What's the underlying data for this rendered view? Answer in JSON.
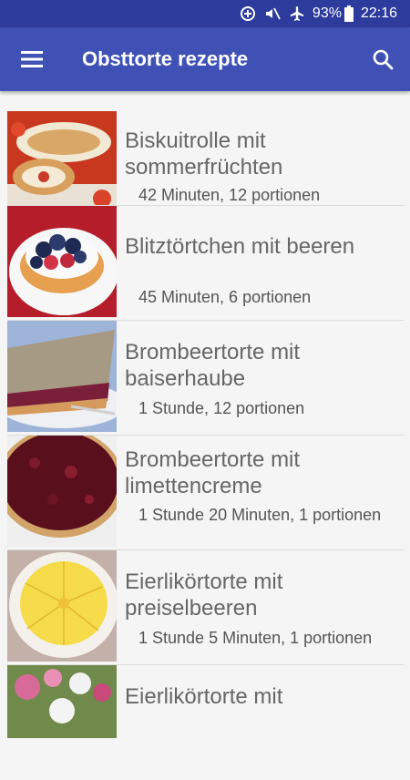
{
  "status": {
    "battery": "93%",
    "time": "22:16"
  },
  "appbar": {
    "title": "Obsttorte rezepte"
  },
  "recipes": [
    {
      "title": "Biskuitrolle mit sommerfrüchten",
      "meta": "42 Minuten, 12 portionen"
    },
    {
      "title": "Blitztörtchen mit beeren",
      "meta": "45 Minuten, 6 portionen"
    },
    {
      "title": "Brombeertorte mit baiserhaube",
      "meta": "1 Stunde, 12 portionen"
    },
    {
      "title": "Brombeertorte mit limettencreme",
      "meta": "1 Stunde 20 Minuten, 1 portionen"
    },
    {
      "title": "Eierlikörtorte mit preiselbeeren",
      "meta": "1 Stunde 5 Minuten, 1 portionen"
    },
    {
      "title": "Eierlikörtorte mit",
      "meta": ""
    }
  ],
  "colors": {
    "statusbar": "#2c3b9c",
    "appbar": "#3f51b5",
    "background": "#f5f5f5"
  }
}
